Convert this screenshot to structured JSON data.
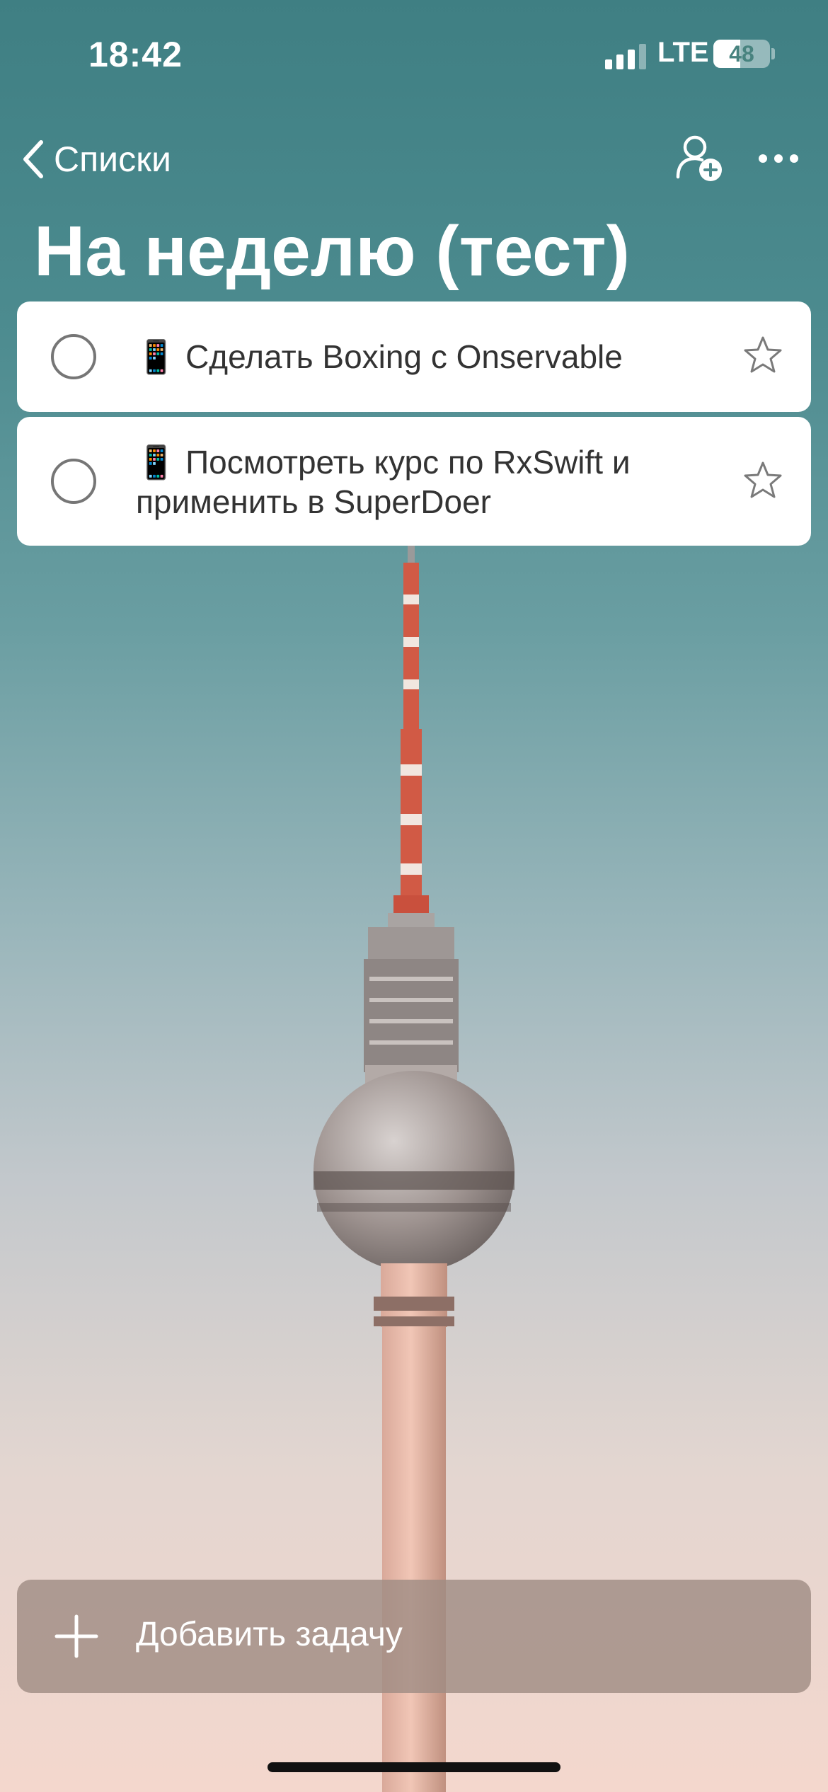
{
  "status_bar": {
    "time": "18:42",
    "network": "LTE",
    "battery_level": "48"
  },
  "nav": {
    "back_label": "Списки"
  },
  "list": {
    "title": "На неделю (тест)",
    "tasks": [
      {
        "emoji": "📱",
        "text": "Сделать Boxing с Onservable",
        "completed": false,
        "starred": false
      },
      {
        "emoji": "📱",
        "text": "Посмотреть курс по RxSwift и применить в SuperDoer",
        "completed": false,
        "starred": false
      }
    ]
  },
  "add_task": {
    "label": "Добавить задачу"
  },
  "colors": {
    "background_top": "#3f7f83",
    "background_bottom": "#f4d7cd",
    "card": "#ffffff",
    "add_bar": "#a08c84"
  },
  "icons": [
    "chevron-left-icon",
    "add-person-icon",
    "more-icon",
    "checkbox-circle-icon",
    "star-icon",
    "plus-icon"
  ]
}
